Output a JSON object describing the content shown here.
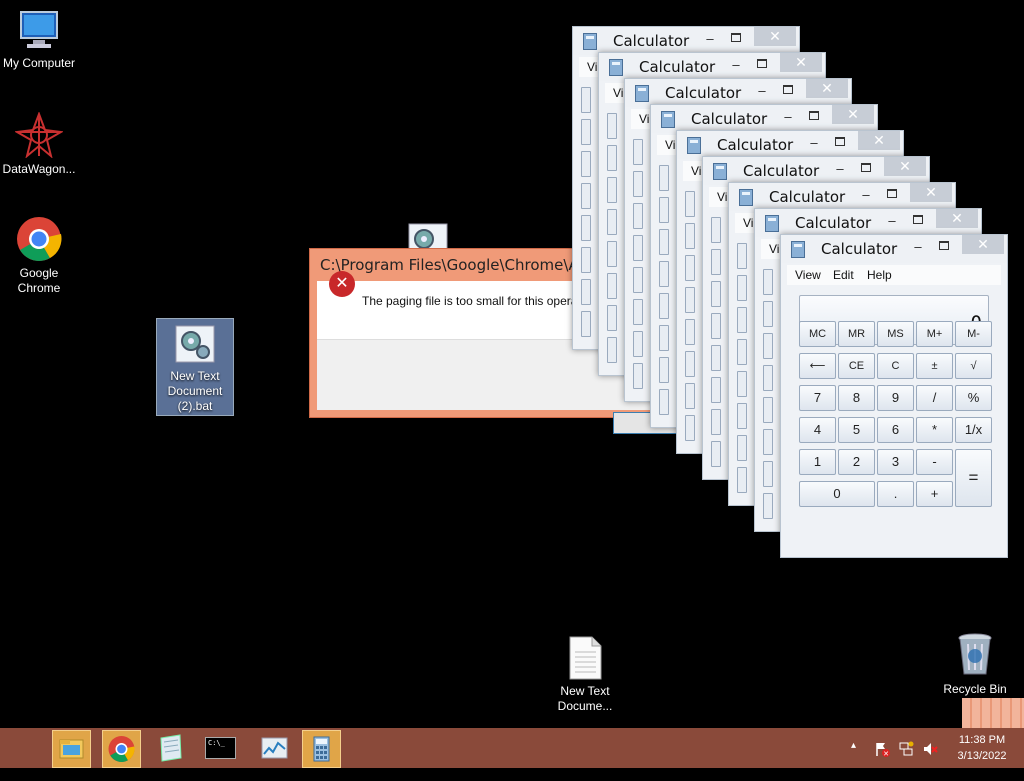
{
  "desktop": {
    "icons": [
      {
        "label": "My Computer",
        "icon": "computer-icon"
      },
      {
        "label": "DataWagon...",
        "icon": "datawagon-icon"
      },
      {
        "label": "Google Chrome",
        "line1": "Google",
        "line2": "Chrome",
        "icon": "chrome-icon"
      },
      {
        "label": "New Text Document (2).bat",
        "line1": "New Text",
        "line2": "Document",
        "line3": "(2).bat",
        "icon": "batch-file-icon"
      },
      {
        "label": "New Text Docume...",
        "line1": "New Text",
        "line2": "Docume...",
        "icon": "text-document-icon"
      },
      {
        "label": "Recycle Bin",
        "icon": "recycle-bin-icon"
      }
    ]
  },
  "error_dialog": {
    "title": "C:\\Program Files\\Google\\Chrome\\Application\\chrome.exe",
    "title_visible": "C:\\Program Files\\Google\\Chrome\\App",
    "message": "The paging file is too small for this opera",
    "icon": "error-icon"
  },
  "calculator": {
    "title": "Calculator",
    "menu": [
      "View",
      "Edit",
      "Help"
    ],
    "menu_partial": "Vi",
    "display": "0",
    "keys": {
      "r1": [
        "MC",
        "MR",
        "MS",
        "M+",
        "M-"
      ],
      "r2": [
        "⟵",
        "CE",
        "C",
        "±",
        "√"
      ],
      "r3": [
        "7",
        "8",
        "9",
        "/",
        "%"
      ],
      "r4": [
        "4",
        "5",
        "6",
        "*",
        "1/x"
      ],
      "r5": [
        "1",
        "2",
        "3",
        "-",
        "="
      ],
      "r6": [
        "0",
        ".",
        "+"
      ]
    },
    "window_count": 9
  },
  "taskbar": {
    "buttons": [
      {
        "name": "file-explorer",
        "icon": "folder-icon"
      },
      {
        "name": "chrome",
        "icon": "chrome-icon"
      },
      {
        "name": "notepad",
        "icon": "notepad-icon"
      },
      {
        "name": "command-prompt",
        "icon": "cmd-icon",
        "text": "C:\\_"
      },
      {
        "name": "task-manager",
        "icon": "performance-icon"
      },
      {
        "name": "calculator",
        "icon": "calculator-icon"
      }
    ],
    "tray": {
      "chevron": "▴",
      "icons": [
        "action-center-flag-icon",
        "network-icon",
        "volume-muted-icon"
      ]
    },
    "clock": {
      "time": "11:38 PM",
      "date": "3/13/2022"
    }
  },
  "colors": {
    "taskbar": "#8a4a3a",
    "error_title_bar": "#f09a78",
    "active_taskbar_button": "#e0a548",
    "desktop": "#000000"
  }
}
